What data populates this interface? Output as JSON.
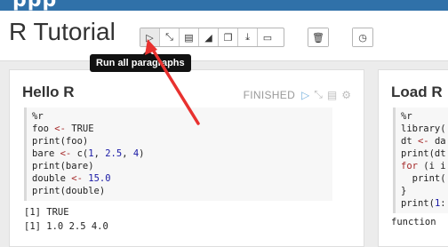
{
  "brand": {
    "text": "ppp"
  },
  "header": {
    "title": "R Tutorial",
    "toolbar": [
      {
        "name": "run-all-button",
        "icon": "play-icon",
        "glyph": "▷"
      },
      {
        "name": "toggle-editor-button",
        "icon": "collapse-icon",
        "glyph": "⤡"
      },
      {
        "name": "toggle-output-button",
        "icon": "book-icon",
        "glyph": "▤"
      },
      {
        "name": "clear-output-button",
        "icon": "eraser-icon",
        "glyph": "◢"
      },
      {
        "name": "clone-note-button",
        "icon": "copy-icon",
        "glyph": "❐"
      },
      {
        "name": "export-note-button",
        "icon": "download-icon",
        "glyph": "⤓"
      },
      {
        "name": "version-button",
        "icon": "file-icon",
        "glyph": "▭"
      }
    ],
    "trash_glyph": "🗑",
    "schedule_glyph": "◷"
  },
  "tooltip": "Run all paragraphs",
  "paragraphs": [
    {
      "title": "Hello R",
      "status": "FINISHED",
      "code": [
        "%r",
        "foo <- TRUE",
        "print(foo)",
        "bare <- c(1, 2.5, 4)",
        "print(bare)",
        "double <- 15.0",
        "print(double)"
      ],
      "output": [
        "[1] TRUE",
        "[1] 1.0 2.5 4.0"
      ]
    },
    {
      "title": "Load R",
      "code": [
        "%r",
        "library(",
        "dt <- da",
        "print(dt",
        "for (i i",
        "  print(",
        "}",
        "print(1:"
      ],
      "output": [
        "function"
      ]
    }
  ]
}
